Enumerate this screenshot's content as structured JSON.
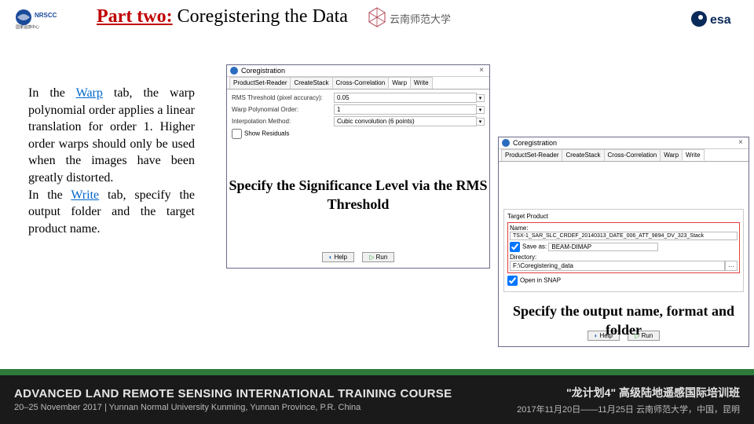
{
  "header": {
    "part_label": "Part two:",
    "title": " Coregistering the Data",
    "ynnu_text": "云南师范大学"
  },
  "body": {
    "p1a": "In the ",
    "p1_link1": "Warp",
    "p1b": " tab, the warp polynomial order applies a linear translation for order 1. Higher order warps should only be used when the images have been greatly distorted.",
    "p2a": "In the ",
    "p2_link1": "Write",
    "p2b": " tab, specify the output folder and the target product name."
  },
  "dlg1": {
    "title": "Coregistration",
    "tabs": [
      "ProductSet-Reader",
      "CreateStack",
      "Cross-Correlation",
      "Warp",
      "Write"
    ],
    "active_tab": 3,
    "fields": {
      "rms_label": "RMS Threshold (pixel accuracy):",
      "rms_value": "0.05",
      "poly_label": "Warp Polynomial Order:",
      "poly_value": "1",
      "interp_label": "Interpolation Method:",
      "interp_value": "Cubic convolution (6 points)",
      "show_res": "Show Residuals"
    },
    "btn_help": "Help",
    "btn_run": "Run"
  },
  "dlg2": {
    "title": "Coregistration",
    "tabs": [
      "ProductSet-Reader",
      "CreateStack",
      "Cross-Correlation",
      "Warp",
      "Write"
    ],
    "active_tab": 4,
    "target": {
      "section": "Target Product",
      "name_label": "Name:",
      "name_value": "TSX-1_SAR_SLC_CRDEF_20140313_DATE_006_ATT_9894_DV_323_Stack",
      "save_label": "Save as:",
      "save_value": "BEAM-DIMAP",
      "dir_label": "Directory:",
      "dir_value": "F:\\Coregistering_data",
      "open": "Open in SNAP"
    },
    "btn_help": "Help",
    "btn_run": "Run"
  },
  "annot": {
    "a1": "Specify the Significance Level via the RMS Threshold",
    "a2": "Specify the output name, format and folder"
  },
  "footer": {
    "left_title": "ADVANCED LAND REMOTE SENSING INTERNATIONAL TRAINING COURSE",
    "left_sub": "20–25 November 2017 | Yunnan Normal University Kunming, Yunnan Province, P.R. China",
    "right_title": "\"龙计划4\" 高级陆地遥感国际培训班",
    "right_sub": "2017年11月20日——11月25日  云南师范大学，中国，昆明"
  }
}
